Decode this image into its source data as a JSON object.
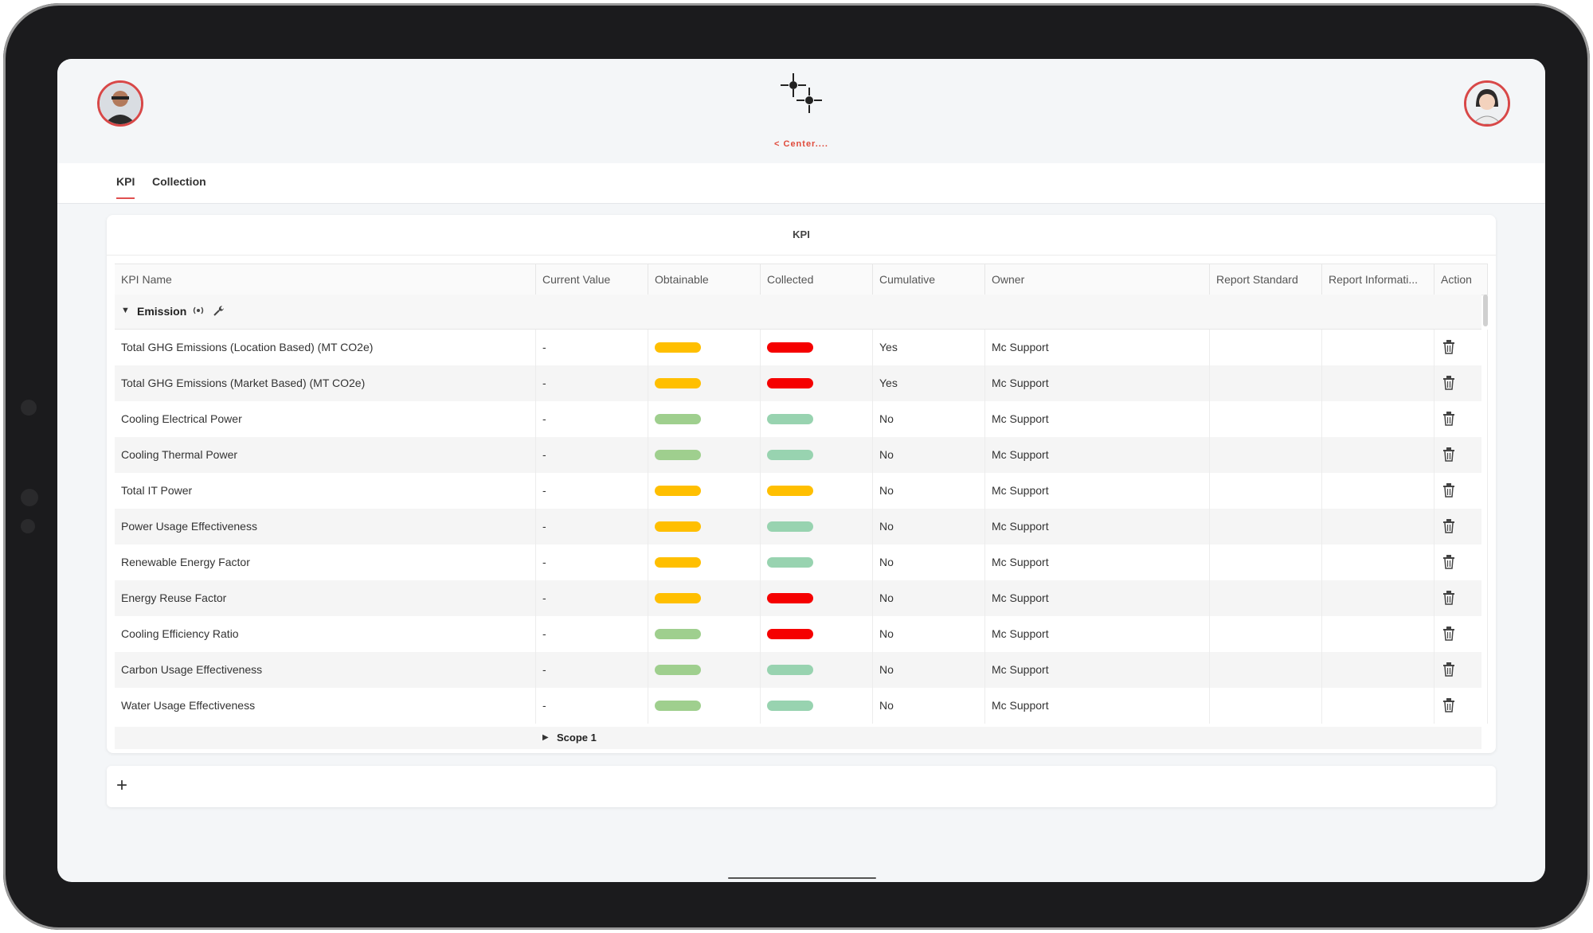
{
  "app": {
    "back_link": "< Center....",
    "logo_icon": "sparkle-crosshair-icon"
  },
  "tabs": [
    {
      "label": "KPI",
      "active": true
    },
    {
      "label": "Collection",
      "active": false
    }
  ],
  "card": {
    "title": "KPI"
  },
  "columns": [
    "KPI Name",
    "Current Value",
    "Obtainable",
    "Collected",
    "Cumulative",
    "Owner",
    "Report Standard",
    "Report Informati...",
    "Action"
  ],
  "group": {
    "label": "Emission",
    "icons": [
      "broadcast-icon",
      "wrench-icon"
    ]
  },
  "status_colors": {
    "yellow": "#ffbf00",
    "red": "#f50000",
    "green": "#9fcf8e",
    "teal": "#98d3b0"
  },
  "rows": [
    {
      "name": "Total GHG Emissions (Location Based) (MT CO2e)",
      "current": "-",
      "obtainable": "yellow",
      "collected": "red",
      "cumulative": "Yes",
      "owner": "Mc Support"
    },
    {
      "name": "Total GHG Emissions (Market Based) (MT CO2e)",
      "current": "-",
      "obtainable": "yellow",
      "collected": "red",
      "cumulative": "Yes",
      "owner": "Mc Support"
    },
    {
      "name": "Cooling Electrical Power",
      "current": "-",
      "obtainable": "green",
      "collected": "teal",
      "cumulative": "No",
      "owner": "Mc Support"
    },
    {
      "name": "Cooling Thermal Power",
      "current": "-",
      "obtainable": "green",
      "collected": "teal",
      "cumulative": "No",
      "owner": "Mc Support"
    },
    {
      "name": "Total IT Power",
      "current": "-",
      "obtainable": "yellow",
      "collected": "yellow",
      "cumulative": "No",
      "owner": "Mc Support"
    },
    {
      "name": "Power Usage Effectiveness",
      "current": "-",
      "obtainable": "yellow",
      "collected": "teal",
      "cumulative": "No",
      "owner": "Mc Support"
    },
    {
      "name": "Renewable Energy Factor",
      "current": "-",
      "obtainable": "yellow",
      "collected": "teal",
      "cumulative": "No",
      "owner": "Mc Support"
    },
    {
      "name": "Energy Reuse Factor",
      "current": "-",
      "obtainable": "yellow",
      "collected": "red",
      "cumulative": "No",
      "owner": "Mc Support"
    },
    {
      "name": "Cooling Efficiency Ratio",
      "current": "-",
      "obtainable": "green",
      "collected": "red",
      "cumulative": "No",
      "owner": "Mc Support"
    },
    {
      "name": "Carbon Usage Effectiveness",
      "current": "-",
      "obtainable": "green",
      "collected": "teal",
      "cumulative": "No",
      "owner": "Mc Support"
    },
    {
      "name": "Water Usage Effectiveness",
      "current": "-",
      "obtainable": "green",
      "collected": "teal",
      "cumulative": "No",
      "owner": "Mc Support"
    }
  ],
  "subgroup": {
    "label": "Scope 1"
  },
  "add_label": "+"
}
